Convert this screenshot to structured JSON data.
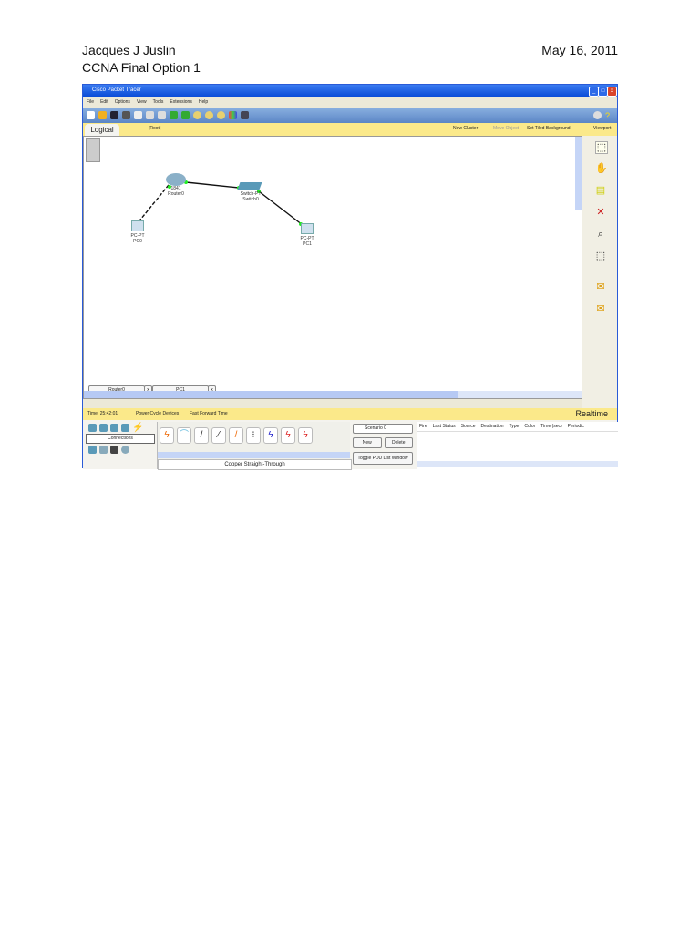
{
  "doc": {
    "author": "Jacques J Juslin",
    "date": "May 16, 2011",
    "subtitle": "CCNA Final Option 1"
  },
  "window": {
    "title": "Cisco Packet Tracer",
    "menu": [
      "File",
      "Edit",
      "Options",
      "View",
      "Tools",
      "Extensions",
      "Help"
    ]
  },
  "workspace": {
    "tab": "Logical",
    "path": "[Root]",
    "new_cluster": "New Cluster",
    "move_object": "Move Object",
    "set_bg": "Set Tiled Background",
    "viewport": "Viewport"
  },
  "devices": [
    {
      "model": "1841",
      "name": "Router0"
    },
    {
      "model": "Switch-PT",
      "name": "Switch0"
    },
    {
      "model": "PC-PT",
      "name": "PC0"
    },
    {
      "model": "PC-PT",
      "name": "PC1"
    }
  ],
  "pdu_tabs": [
    "Router0",
    "PC1"
  ],
  "status": {
    "time": "Time: 25:42:01",
    "power": "Power Cycle Devices",
    "fft": "Fast Forward Time",
    "mode": "Realtime"
  },
  "bottom": {
    "category": "Connections",
    "selected_cable": "Copper Straight-Through",
    "scenario": "Scenario 0",
    "new": "New",
    "delete": "Delete",
    "toggle": "Toggle PDU List Window",
    "columns": [
      "Fire",
      "Last Status",
      "Source",
      "Destination",
      "Type",
      "Color",
      "Time (sec)",
      "Periodic"
    ]
  }
}
